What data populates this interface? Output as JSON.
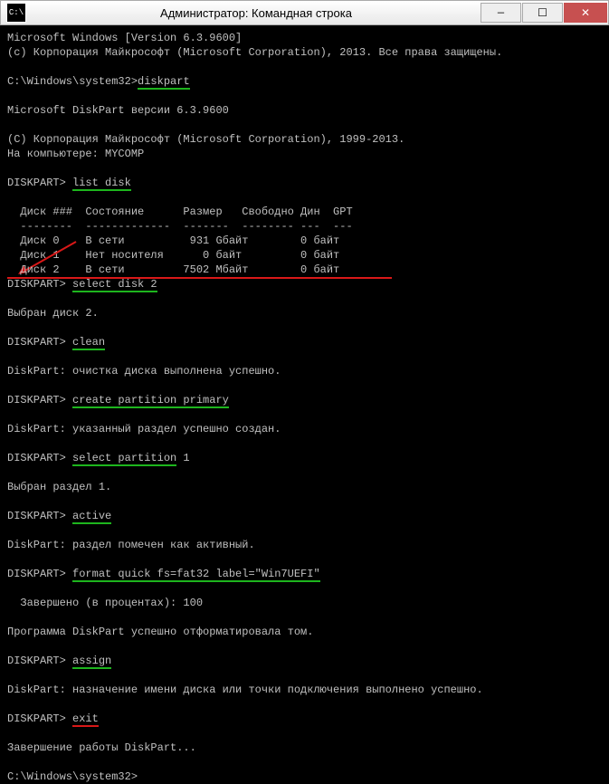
{
  "titlebar": {
    "title": "Администратор: Командная строка"
  },
  "win": {
    "min": "—",
    "max": "☐",
    "close": "✕"
  },
  "l": {
    "ver": "Microsoft Windows [Version 6.3.9600]",
    "cpr": "(с) Корпорация Майкрософт (Microsoft Corporation), 2013. Все права защищены.",
    "p1": "C:\\Windows\\system32>",
    "c1": "diskpart",
    "dpver": "Microsoft DiskPart версии 6.3.9600",
    "mscopy": "(C) Корпорация Майкрософт (Microsoft Corporation), 1999-2013.",
    "comp": "На компьютере: MYCOMP",
    "dp": "DISKPART> ",
    "c2": "list disk",
    "th": "  Диск ###  Состояние      Размер   Свободно Дин  GPT",
    "tsep": "  --------  -------------  -------  -------- ---  ---",
    "r0": "  Диск 0    В сети          931 Gбайт        0 байт        ",
    "r1": "  Диск 1    Нет носителя      0 байт         0 байт        ",
    "r2a": "  Диск 2    В сети         7502 Mбайт        0 байт        ",
    "c3": "select disk 2",
    "o3": "Выбран диск 2.",
    "c4": "clean",
    "o4": "DiskPart: очистка диска выполнена успешно.",
    "c5": "create partition primary",
    "o5": "DiskPart: указанный раздел успешно создан.",
    "c6a": "select partition",
    "c6b": " 1",
    "o6": "Выбран раздел 1.",
    "c7": "active",
    "o7": "DiskPart: раздел помечен как активный.",
    "c8": "format quick fs=fat32 label=\"Win7UEFI\"",
    "o8a": "  Завершено (в процентах): 100",
    "o8b": "Программа DiskPart успешно отформатировала том.",
    "c9": "assign",
    "o9": "DiskPart: назначение имени диска или точки подключения выполнено успешно.",
    "c10": "exit",
    "o10": "Завершение работы DiskPart...",
    "p2": "C:\\Windows\\system32>"
  }
}
